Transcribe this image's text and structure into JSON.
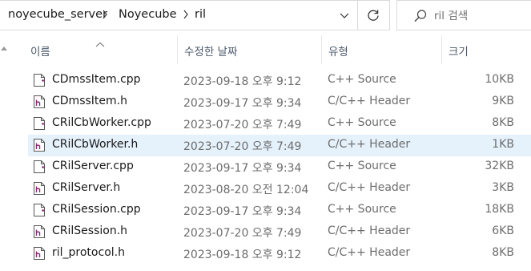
{
  "address_bar": {
    "breadcrumbs": [
      "noyecube_server",
      "Noyecube",
      "ril"
    ],
    "separator_icon": "chevron-right-icon",
    "dropdown_icon": "chevron-down-icon",
    "refresh_icon": "refresh-icon"
  },
  "search": {
    "placeholder": "ril 검색",
    "icon": "search-icon"
  },
  "columns": {
    "name": "이름",
    "date": "수정한 날짜",
    "type": "유형",
    "size": "크기"
  },
  "files": [
    {
      "name": "CDmssItem.cpp",
      "date": "2023-09-18 오후 9:12",
      "type": "C++ Source",
      "size": "10KB",
      "icon": "cpp-file-icon",
      "selected": false
    },
    {
      "name": "CDmssItem.h",
      "date": "2023-09-17 오후 9:34",
      "type": "C/C++ Header",
      "size": "9KB",
      "icon": "header-file-icon",
      "selected": false
    },
    {
      "name": "CRilCbWorker.cpp",
      "date": "2023-07-20 오후 7:49",
      "type": "C++ Source",
      "size": "8KB",
      "icon": "cpp-file-icon",
      "selected": false
    },
    {
      "name": "CRilCbWorker.h",
      "date": "2023-07-20 오후 7:49",
      "type": "C/C++ Header",
      "size": "1KB",
      "icon": "header-file-icon",
      "selected": true
    },
    {
      "name": "CRilServer.cpp",
      "date": "2023-09-17 오후 9:34",
      "type": "C++ Source",
      "size": "32KB",
      "icon": "cpp-file-icon",
      "selected": false
    },
    {
      "name": "CRilServer.h",
      "date": "2023-08-20 오전 12:04",
      "type": "C/C++ Header",
      "size": "3KB",
      "icon": "header-file-icon",
      "selected": false
    },
    {
      "name": "CRilSession.cpp",
      "date": "2023-09-17 오후 9:34",
      "type": "C++ Source",
      "size": "18KB",
      "icon": "cpp-file-icon",
      "selected": false
    },
    {
      "name": "CRilSession.h",
      "date": "2023-07-20 오후 7:49",
      "type": "C/C++ Header",
      "size": "6KB",
      "icon": "header-file-icon",
      "selected": false
    },
    {
      "name": "ril_protocol.h",
      "date": "2023-09-18 오후 9:12",
      "type": "C/C++ Header",
      "size": "8KB",
      "icon": "header-file-icon",
      "selected": false
    }
  ],
  "colors": {
    "selected_row": "#e5f1fb",
    "header_text": "#4c5a6b",
    "icon_accent": "#8a2a7a"
  }
}
